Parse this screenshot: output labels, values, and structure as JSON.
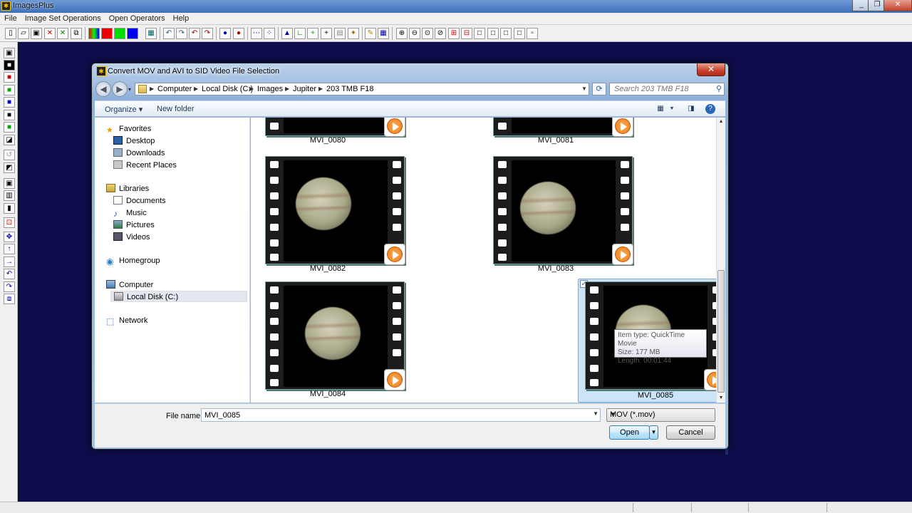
{
  "app": {
    "title": "ImagesPlus",
    "menu": [
      "File",
      "Image Set Operations",
      "Open Operators",
      "Help"
    ],
    "window_buttons": [
      "_",
      "❐",
      "✕"
    ]
  },
  "dialog": {
    "title": "Convert MOV and AVI to SID Video File Selection",
    "close_label": "✕",
    "breadcrumb": [
      "Computer",
      "Local Disk (C:)",
      "Images",
      "Jupiter",
      "203 TMB F18"
    ],
    "search_placeholder": "Search 203 TMB F18",
    "commands": {
      "organize": "Organize ▾",
      "new_folder": "New folder"
    },
    "nav": {
      "favorites": "Favorites",
      "desktop": "Desktop",
      "downloads": "Downloads",
      "recent": "Recent Places",
      "libraries": "Libraries",
      "documents": "Documents",
      "music": "Music",
      "pictures": "Pictures",
      "videos": "Videos",
      "homegroup": "Homegroup",
      "computer": "Computer",
      "local_disk": "Local Disk (C:)",
      "network": "Network"
    },
    "files": [
      "MVI_0080",
      "MVI_0081",
      "MVI_0082",
      "MVI_0083",
      "MVI_0084",
      "MVI_0085"
    ],
    "selected_file": "MVI_0085",
    "tooltip": {
      "type": "Item type: QuickTime Movie",
      "size": "Size: 177 MB",
      "length": "Length: 00:01:44"
    },
    "filename_label": "File name:",
    "filename_value": "MVI_0085",
    "filter": "MOV (*.mov)",
    "open_label": "Open",
    "cancel_label": "Cancel"
  }
}
